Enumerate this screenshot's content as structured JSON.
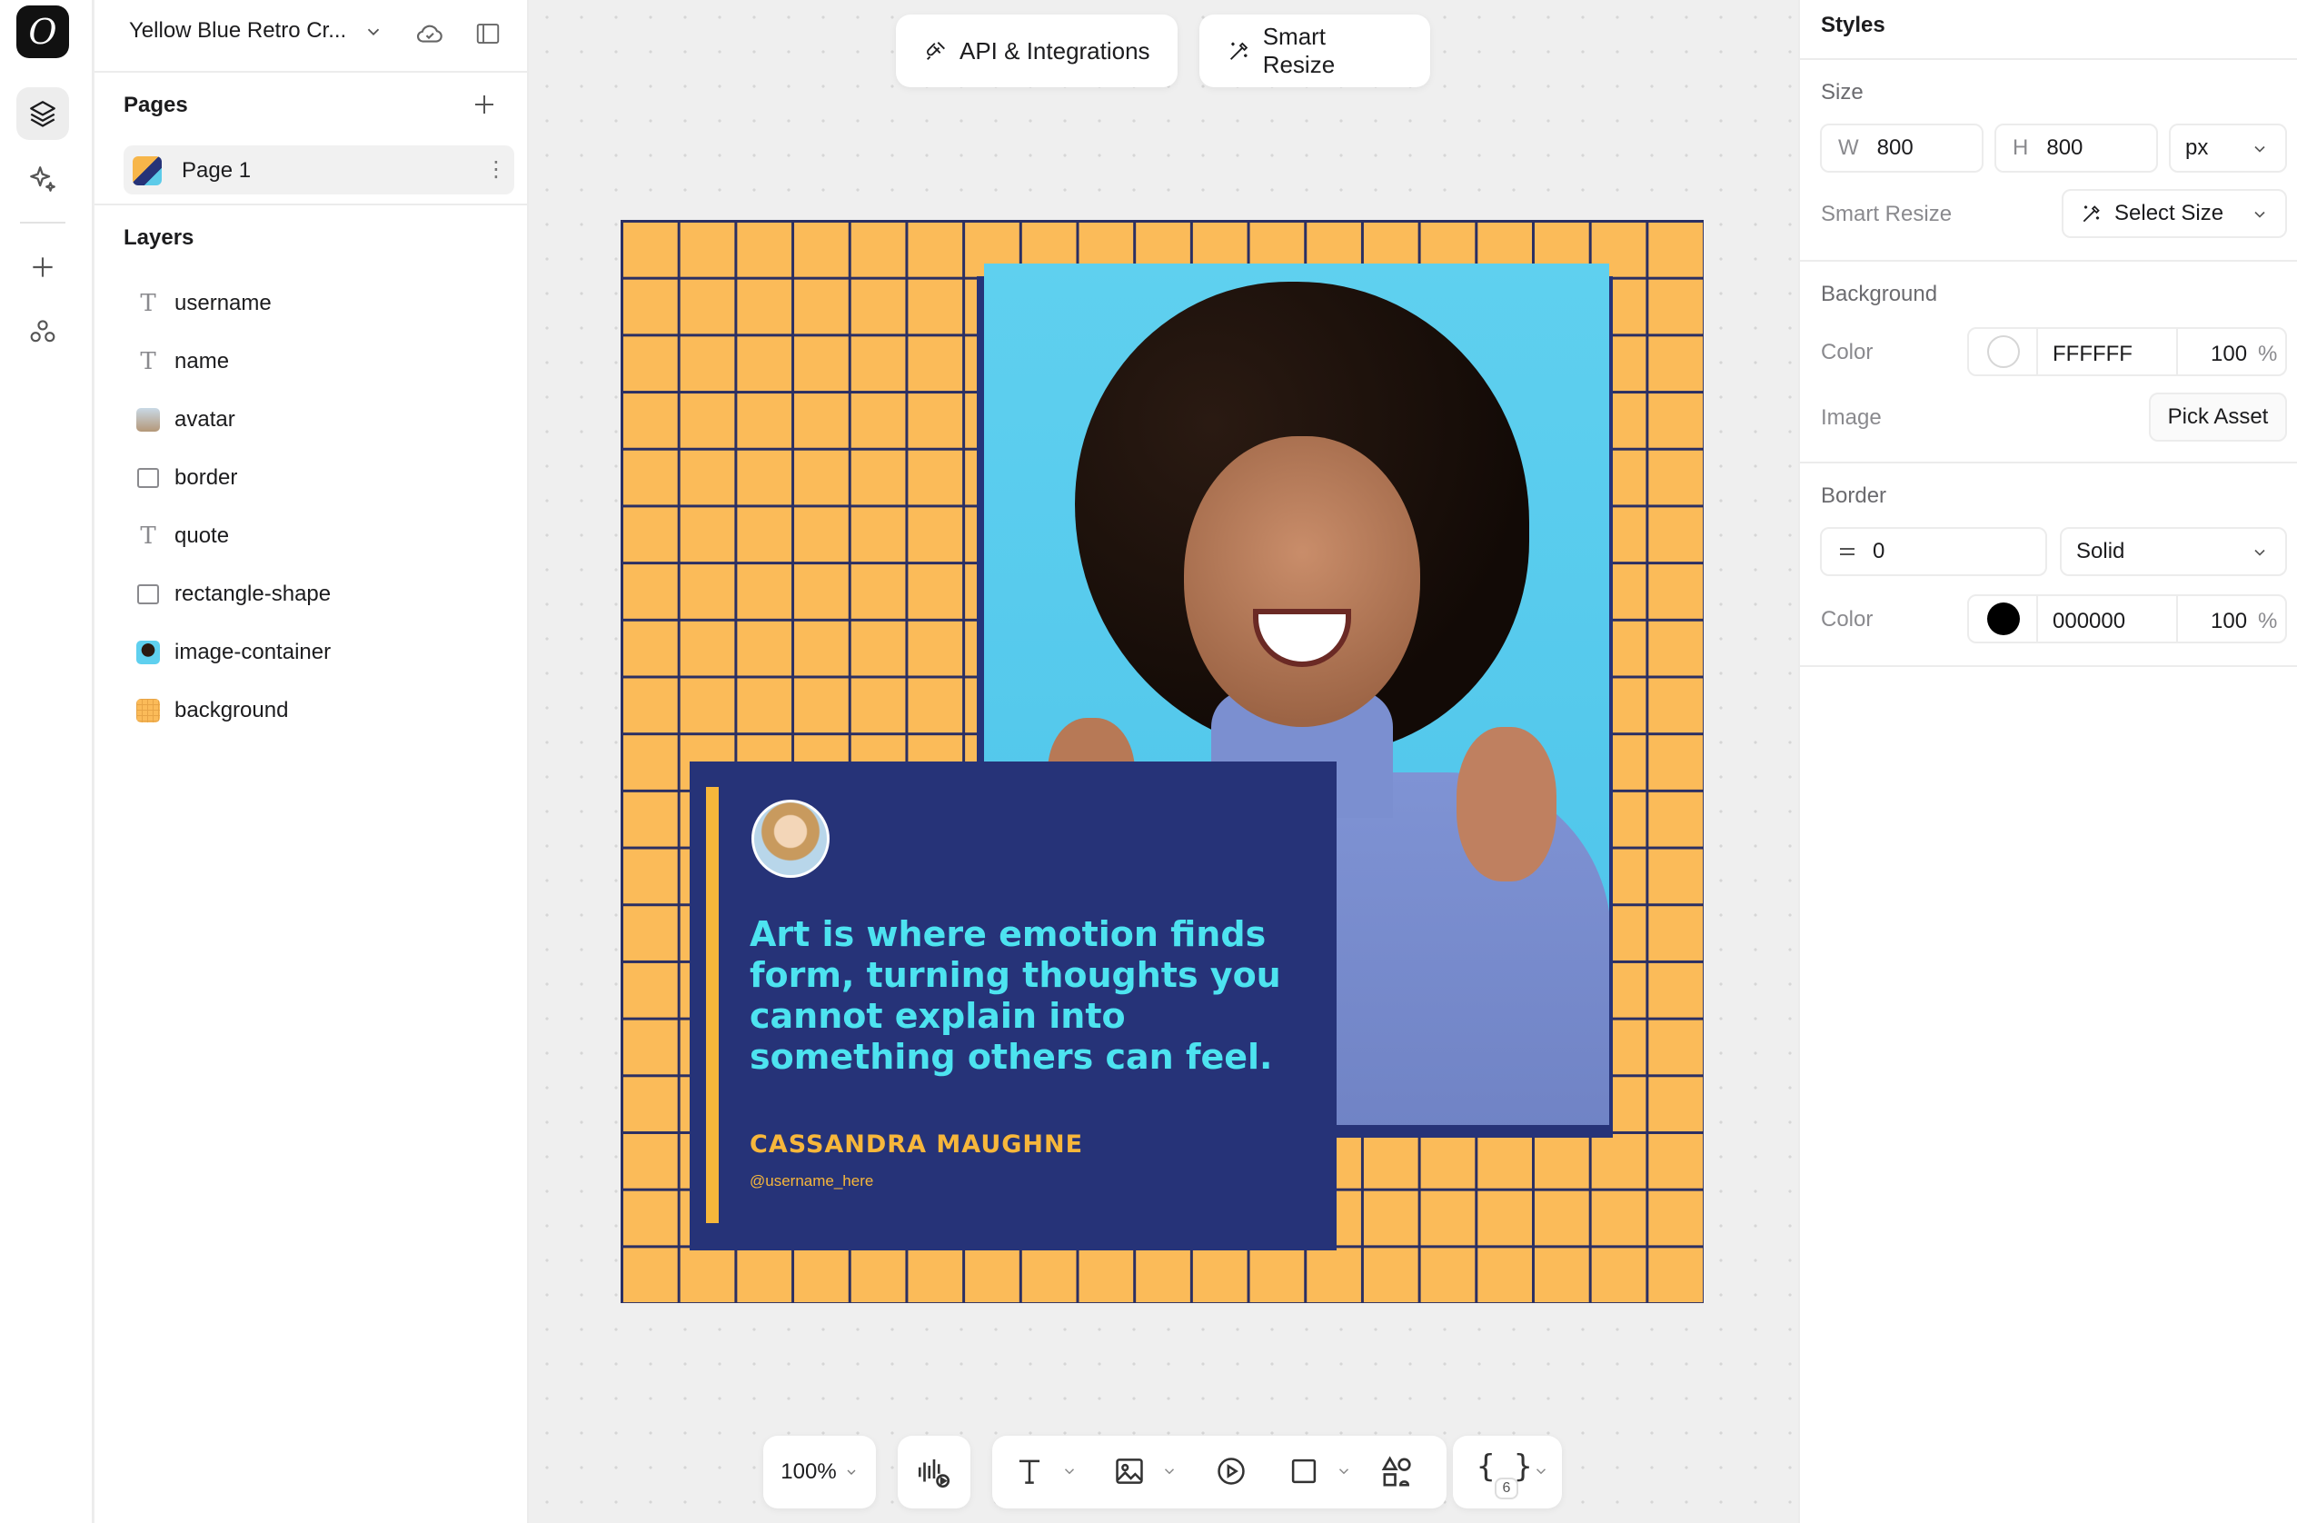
{
  "document": {
    "title": "Yellow Blue Retro Cr..."
  },
  "pages": {
    "heading": "Pages",
    "items": [
      {
        "label": "Page 1"
      }
    ]
  },
  "layers": {
    "heading": "Layers",
    "items": [
      {
        "label": "username",
        "icon": "text-icon"
      },
      {
        "label": "name",
        "icon": "text-icon"
      },
      {
        "label": "avatar",
        "icon": "image-thumb-icon"
      },
      {
        "label": "border",
        "icon": "rectangle-icon"
      },
      {
        "label": "quote",
        "icon": "text-icon"
      },
      {
        "label": "rectangle-shape",
        "icon": "rectangle-icon"
      },
      {
        "label": "image-container",
        "icon": "image-thumb-icon"
      },
      {
        "label": "background",
        "icon": "grid-thumb-icon"
      }
    ]
  },
  "top_actions": {
    "api": "API & Integrations",
    "resize": "Smart Resize"
  },
  "design": {
    "quote": "Art is where emotion finds form, turning thoughts you cannot explain into something others can feel.",
    "name": "CASSANDRA MAUGHNE",
    "username": "@username_here",
    "colors": {
      "background": "#FBBB59",
      "grid": "#2B2F63",
      "card": "#263378",
      "quote_text": "#4DE3F0",
      "accent": "#F7B73B",
      "photo_bg": "#5FD0EF"
    }
  },
  "toolbar": {
    "zoom": "100%",
    "code_badge": "6"
  },
  "styles": {
    "title": "Styles",
    "size": {
      "heading": "Size",
      "w_label": "W",
      "w_value": "800",
      "h_label": "H",
      "h_value": "800",
      "unit": "px",
      "smart_resize_label": "Smart Resize",
      "smart_resize_button": "Select Size"
    },
    "background": {
      "heading": "Background",
      "color_label": "Color",
      "color_hex": "FFFFFF",
      "opacity": "100",
      "opacity_unit": "%",
      "image_label": "Image",
      "pick_asset": "Pick Asset"
    },
    "border": {
      "heading": "Border",
      "width": "0",
      "style": "Solid",
      "color_label": "Color",
      "color_hex": "000000",
      "opacity": "100",
      "opacity_unit": "%"
    }
  }
}
